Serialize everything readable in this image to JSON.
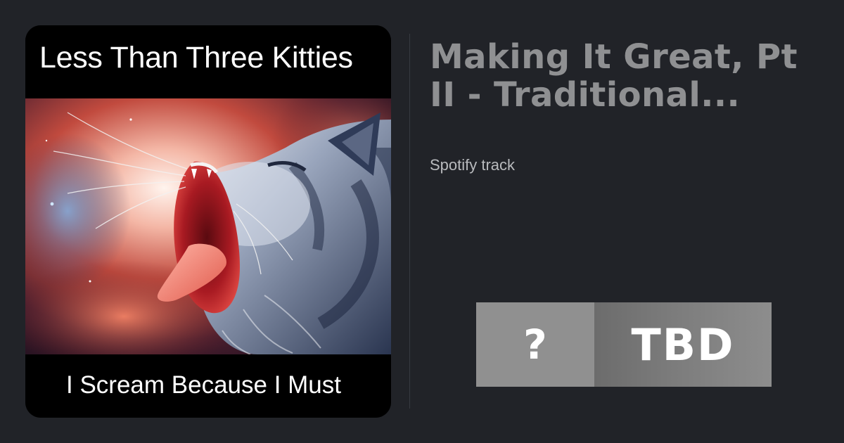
{
  "cover": {
    "top_text": "Less Than Three Kitties",
    "bottom_text": "I Scream Because I Must"
  },
  "track": {
    "title_line1": "Making It Great, Pt",
    "title_line2": "II - Traditional...",
    "subtitle": "Spotify track"
  },
  "rating": {
    "score": "?",
    "label": "TBD"
  },
  "colors": {
    "background": "#212328",
    "title": "#8f9092",
    "subtitle": "#b8babd",
    "badge_score_bg": "#909090",
    "badge_label_bg": "#7c7c7c"
  }
}
